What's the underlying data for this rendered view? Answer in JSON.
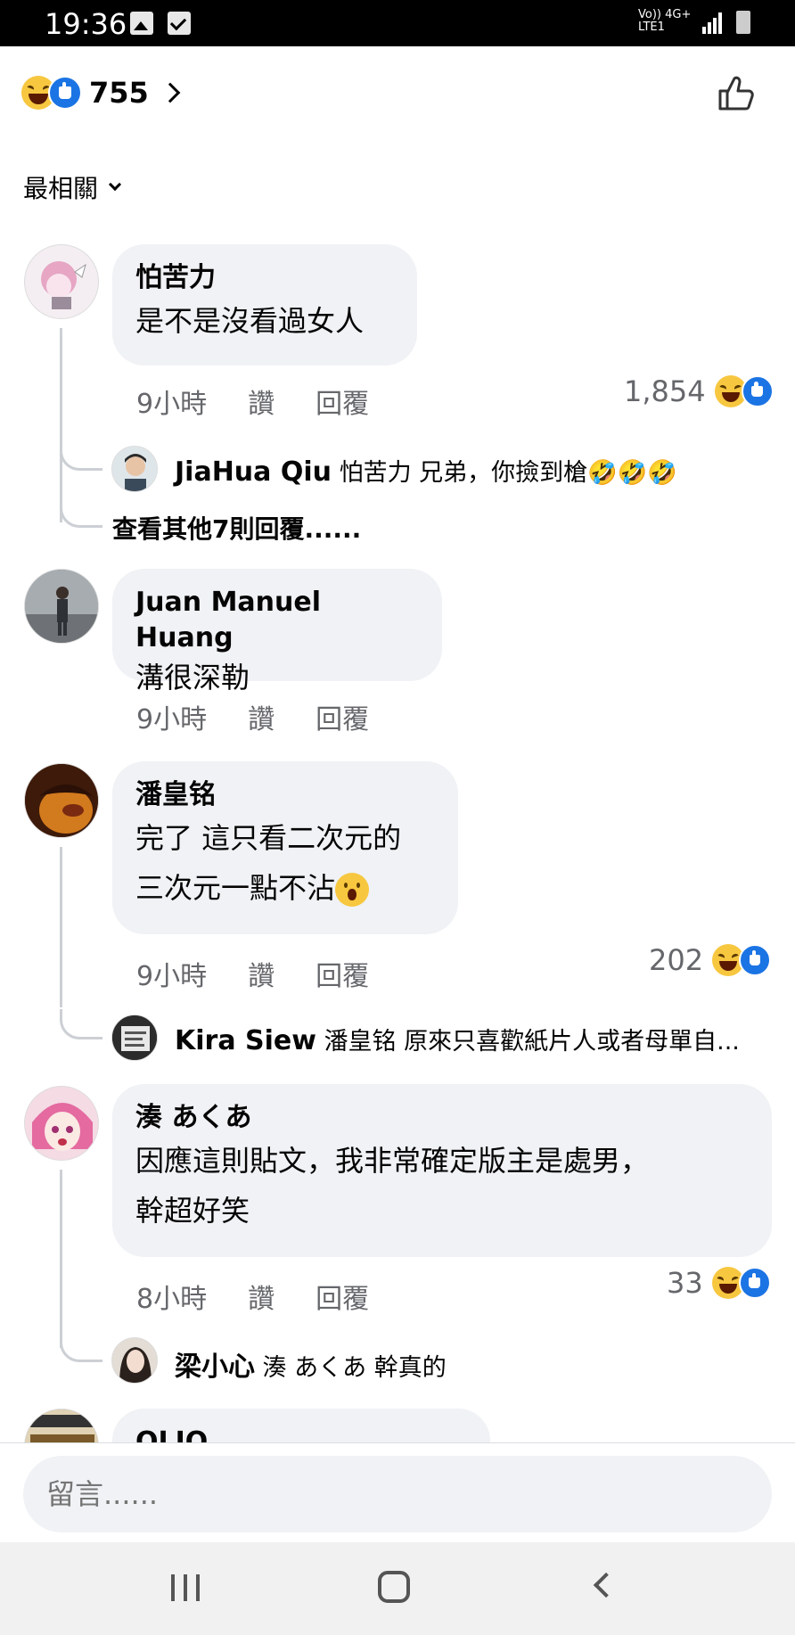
{
  "status_bar": {
    "time": "19:36",
    "net_volte": "Vo)) 4G+",
    "net_lte": "LTE1"
  },
  "header": {
    "reaction_count": "755",
    "sort_label": "最相關"
  },
  "comments": [
    {
      "author": "怕苦力",
      "text": "是不是沒看過女人",
      "time": "9小時",
      "like_label": "讚",
      "reply_label": "回覆",
      "reaction_count": "1,854",
      "reply": {
        "author": "JiaHua Qiu",
        "text": "怕苦力 兄弟，你撿到槍🤣🤣🤣"
      },
      "more_replies": "查看其他7則回覆......"
    },
    {
      "author": "Juan Manuel Huang",
      "text": "溝很深勒",
      "time": "9小時",
      "like_label": "讚",
      "reply_label": "回覆"
    },
    {
      "author": "潘皇铭",
      "text_line1": "完了 這只看二次元的",
      "text_line2": "三次元一點不沾",
      "time": "9小時",
      "like_label": "讚",
      "reply_label": "回覆",
      "reaction_count": "202",
      "reply": {
        "author": "Kira Siew",
        "text": "潘皇铭 原來只喜歡紙片人或者母單自..."
      }
    },
    {
      "author": "湊 あくあ",
      "text_line1": "因應這則貼文，我非常確定版主是處男，",
      "text_line2": "幹超好笑",
      "time": "8小時",
      "like_label": "讚",
      "reply_label": "回覆",
      "reaction_count": "33",
      "reply": {
        "author": "梁小心",
        "text": "湊 あくあ 幹真的"
      }
    },
    {
      "author": "OLIO"
    }
  ],
  "composer": {
    "placeholder": "留言......"
  },
  "colors": {
    "bubble": "#f0f2f5",
    "like_blue": "#1b74e4",
    "haha_yellow": "#f7c740",
    "meta_gray": "#65676b"
  }
}
